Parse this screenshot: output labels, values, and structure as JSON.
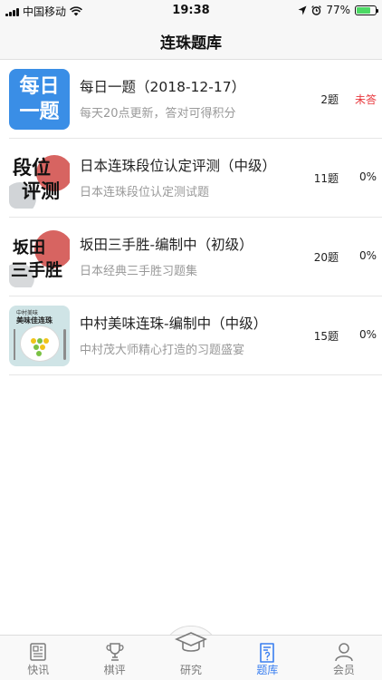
{
  "status_bar": {
    "carrier": "中国移动",
    "time": "19:38",
    "battery_percent": "77%",
    "battery_level": 0.77
  },
  "nav": {
    "title": "连珠题库"
  },
  "items": [
    {
      "thumb_lines": [
        "每日",
        "一题"
      ],
      "title": "每日一题（2018-12-17）",
      "subtitle": "每天20点更新，答对可得积分",
      "count": "2题",
      "status": "未答"
    },
    {
      "thumb_lines": [
        "段位",
        "评测"
      ],
      "title": "日本连珠段位认定评测（中级）",
      "subtitle": "日本连珠段位认定测试题",
      "count": "11题",
      "status": "0%"
    },
    {
      "thumb_lines": [
        "坂田",
        "三手胜"
      ],
      "title": "坂田三手胜-编制中（初级）",
      "subtitle": "日本经典三手胜习题集",
      "count": "20题",
      "status": "0%"
    },
    {
      "thumb_lines": [
        "中村美味",
        "美味佳连珠"
      ],
      "title": "中村美味连珠-编制中（中级）",
      "subtitle": "中村茂大师精心打造的习题盛宴",
      "count": "15题",
      "status": "0%"
    }
  ],
  "tabs": [
    {
      "label": "快讯",
      "icon": "newspaper-icon"
    },
    {
      "label": "棋评",
      "icon": "trophy-icon"
    },
    {
      "label": "研究",
      "icon": "graduation-cap-icon"
    },
    {
      "label": "题库",
      "icon": "question-document-icon"
    },
    {
      "label": "会员",
      "icon": "person-icon"
    }
  ],
  "colors": {
    "accent": "#3a7ff0",
    "unanswered": "#e8383d",
    "daily_thumb": "#3a8ee6"
  }
}
